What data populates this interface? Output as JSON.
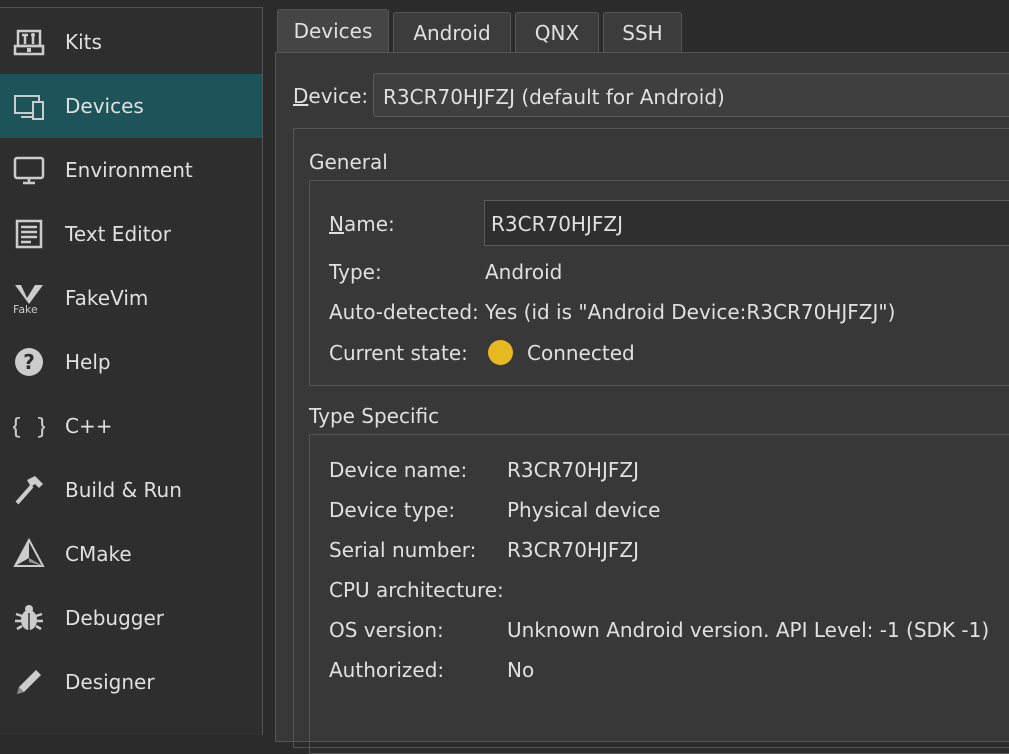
{
  "sidebar": {
    "items": [
      {
        "label": "Kits",
        "icon": "kits-icon"
      },
      {
        "label": "Devices",
        "icon": "devices-icon"
      },
      {
        "label": "Environment",
        "icon": "environment-icon"
      },
      {
        "label": "Text Editor",
        "icon": "text-editor-icon"
      },
      {
        "label": "FakeVim",
        "icon": "fakevim-icon"
      },
      {
        "label": "Help",
        "icon": "help-icon"
      },
      {
        "label": "C++",
        "icon": "cpp-icon"
      },
      {
        "label": "Build & Run",
        "icon": "build-run-icon"
      },
      {
        "label": "CMake",
        "icon": "cmake-icon"
      },
      {
        "label": "Debugger",
        "icon": "debugger-icon"
      },
      {
        "label": "Designer",
        "icon": "designer-icon"
      }
    ],
    "selected": "Devices"
  },
  "tabs": [
    {
      "label": "Devices"
    },
    {
      "label": "Android"
    },
    {
      "label": "QNX"
    },
    {
      "label": "SSH"
    }
  ],
  "device": {
    "label_rest": "evice:",
    "label_mnemonic": "D",
    "selected_value": "R3CR70HJFZJ (default for Android)"
  },
  "general": {
    "title": "General",
    "name_label_mnemonic": "N",
    "name_label_rest": "ame:",
    "name_value": "R3CR70HJFZJ",
    "type_label": "Type:",
    "type_value": "Android",
    "auto_label": "Auto-detected:",
    "auto_value": "Yes (id is \"Android Device:R3CR70HJFZJ\")",
    "state_label": "Current state:",
    "state_value": "Connected",
    "state_color": "#e8b820"
  },
  "type_specific": {
    "title": "Type Specific",
    "rows": [
      {
        "label": "Device name:",
        "value": "R3CR70HJFZJ"
      },
      {
        "label": "Device type:",
        "value": "Physical device"
      },
      {
        "label": "Serial number:",
        "value": "R3CR70HJFZJ"
      },
      {
        "label": "CPU architecture:",
        "value": ""
      },
      {
        "label": "OS version:",
        "value": "Unknown Android version. API Level: -1 (SDK -1)"
      },
      {
        "label": "Authorized:",
        "value": "No"
      }
    ]
  },
  "colors": {
    "selected_sidebar": "#1d5459",
    "background": "#2b2b2b"
  }
}
